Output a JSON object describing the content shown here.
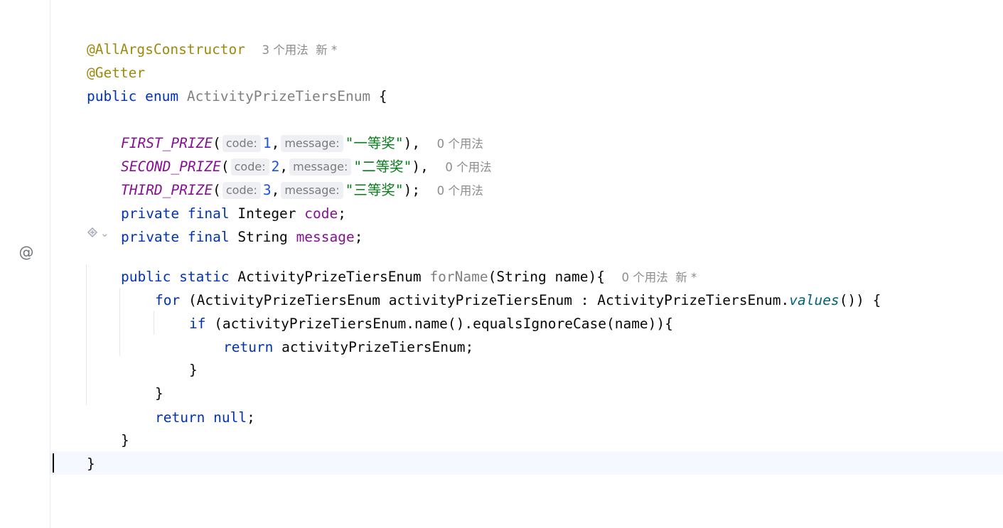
{
  "code": {
    "l1": {
      "annotation": "@AllArgsConstructor",
      "usages": "3 个用法",
      "new_mark": "新 *"
    },
    "l2": {
      "annotation": "@Getter"
    },
    "l3": {
      "kw_public": "public",
      "kw_enum": "enum",
      "class_name": "ActivityPrizeTiersEnum",
      "brace": "{"
    },
    "l5": {
      "const": "FIRST_PRIZE",
      "open": "(",
      "hint_code": "code:",
      "code_val": "1",
      "comma": ",",
      "hint_message": "message:",
      "msg_val": "\"一等奖\"",
      "close": "),",
      "usages": "0 个用法"
    },
    "l6": {
      "const": "SECOND_PRIZE",
      "open": "(",
      "hint_code": "code:",
      "code_val": "2",
      "comma": ",",
      "hint_message": "message:",
      "msg_val": "\"二等奖\"",
      "close": "),",
      "usages": "0 个用法"
    },
    "l7": {
      "const": "THIRD_PRIZE",
      "open": "(",
      "hint_code": "code:",
      "code_val": "3",
      "comma": ",",
      "hint_message": "message:",
      "msg_val": "\"三等奖\"",
      "close": ");",
      "usages": "0 个用法"
    },
    "l8": {
      "kw_private": "private",
      "kw_final": "final",
      "type": "Integer",
      "name": "code",
      "semi": ";"
    },
    "l9": {
      "kw_private": "private",
      "kw_final": "final",
      "type": "String",
      "name": "message",
      "semi": ";"
    },
    "l11": {
      "kw_public": "public",
      "kw_static": "static",
      "type": "ActivityPrizeTiersEnum",
      "method": "forName",
      "params": "(String name){",
      "usages": "0 个用法",
      "new_mark": "新 *"
    },
    "l12": {
      "kw_for": "for",
      "part1": " (ActivityPrizeTiersEnum activityPrizeTiersEnum : ActivityPrizeTiersEnum.",
      "values": "values",
      "part2": "()) {"
    },
    "l13": {
      "kw_if": "if",
      "rest": " (activityPrizeTiersEnum.name().equalsIgnoreCase(name)){"
    },
    "l14": {
      "kw_return": "return",
      "rest": " activityPrizeTiersEnum;"
    },
    "l15": {
      "brace": "}"
    },
    "l16": {
      "brace": "}"
    },
    "l17": {
      "kw_return": "return",
      "kw_null": "null",
      "semi": ";"
    },
    "l18": {
      "brace": "}"
    },
    "l19": {
      "brace": "}"
    }
  },
  "gutter": {
    "at_icon": "@",
    "ai_icon": "ai-assistant-icon",
    "ai_chevron": "⌄"
  },
  "colors": {
    "keyword": "#0033b3",
    "annotation": "#9e880d",
    "enum_constant": "#871094",
    "number": "#1750eb",
    "string": "#067d17",
    "hint_bg": "#eef0f3",
    "current_line": "#f5f8fe"
  }
}
